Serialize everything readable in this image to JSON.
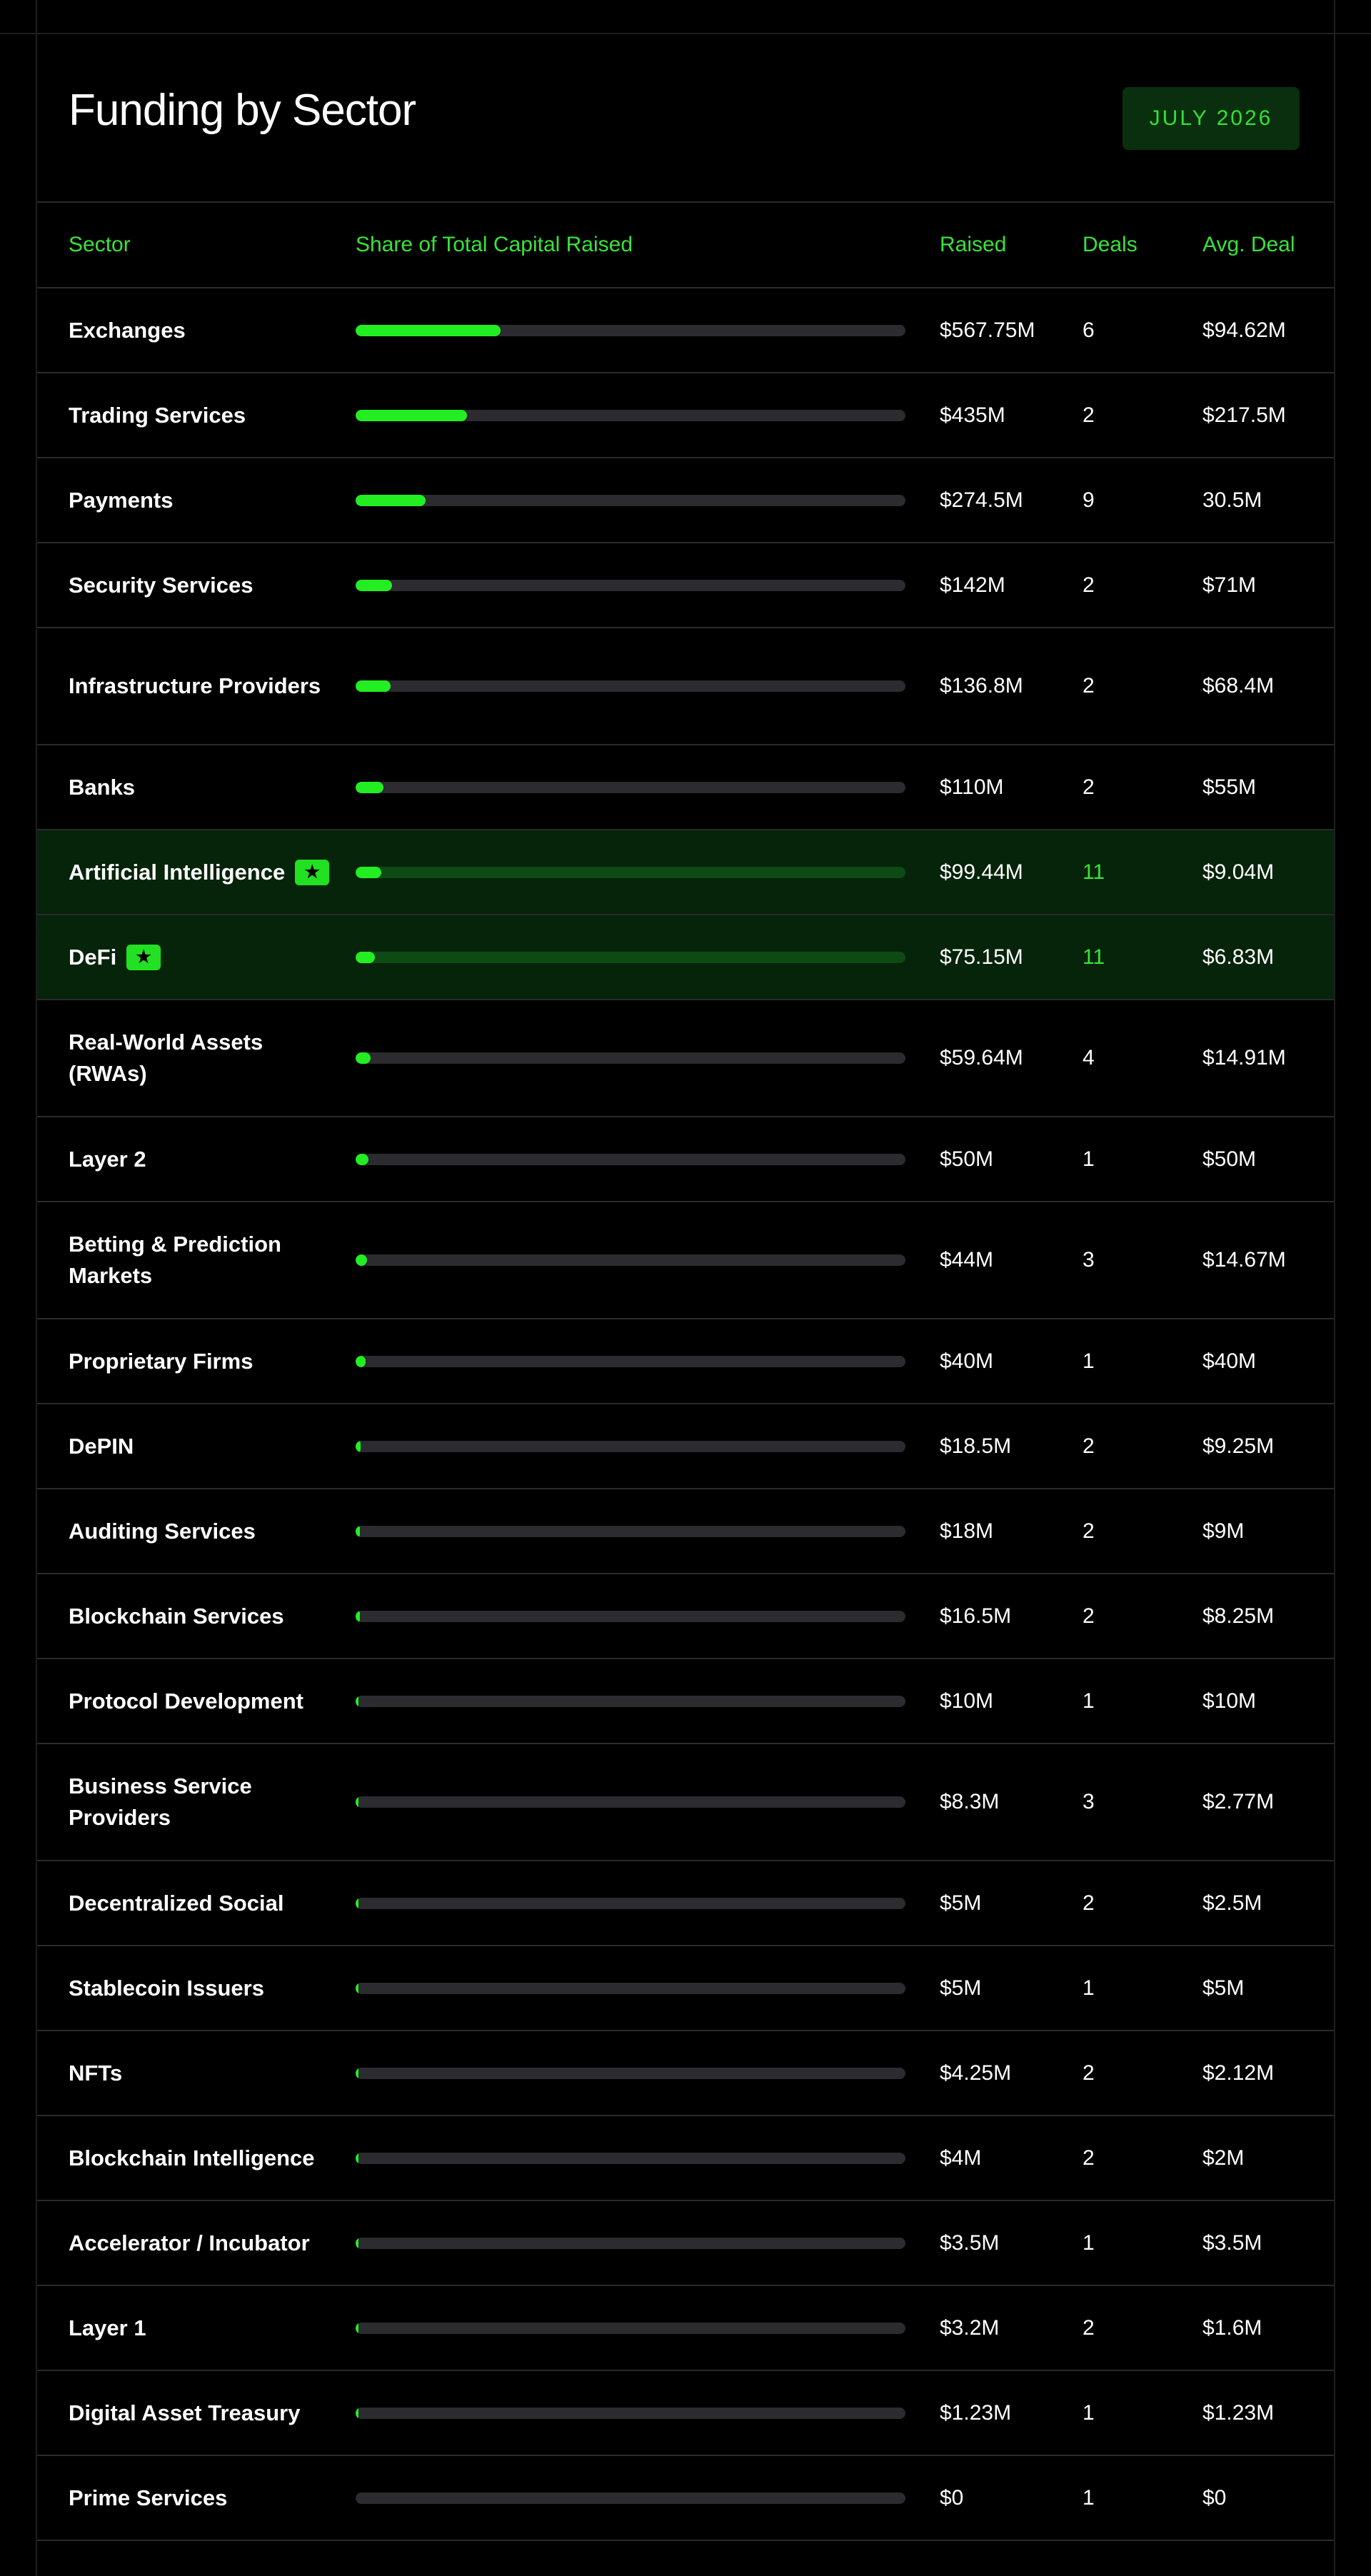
{
  "title": "Funding by Sector",
  "period_badge": "JULY 2026",
  "columns": {
    "sector": "Sector",
    "share": "Share of Total Capital Raised",
    "raised": "Raised",
    "deals": "Deals",
    "avg": "Avg. Deal"
  },
  "colors": {
    "accent": "#22ee22",
    "highlight_row": "#06240a",
    "track": "#2b2b30"
  },
  "chart_data": {
    "type": "table",
    "title": "Funding by Sector",
    "bar_max_millions": 2150,
    "rows": [
      {
        "sector": "Exchanges",
        "raised_m": 567.75,
        "raised": "$567.75M",
        "deals": "6",
        "avg": "$94.62M",
        "highlight": false
      },
      {
        "sector": "Trading Services",
        "raised_m": 435,
        "raised": "$435M",
        "deals": "2",
        "avg": "$217.5M",
        "highlight": false
      },
      {
        "sector": "Payments",
        "raised_m": 274.5,
        "raised": "$274.5M",
        "deals": "9",
        "avg": "30.5M",
        "highlight": false
      },
      {
        "sector": "Security Services",
        "raised_m": 142,
        "raised": "$142M",
        "deals": "2",
        "avg": "$71M",
        "highlight": false
      },
      {
        "sector": "Infrastructure Providers",
        "raised_m": 136.8,
        "raised": "$136.8M",
        "deals": "2",
        "avg": "$68.4M",
        "highlight": false
      },
      {
        "sector": "Banks",
        "raised_m": 110,
        "raised": "$110M",
        "deals": "2",
        "avg": "$55M",
        "highlight": false
      },
      {
        "sector": "Artificial Intelligence",
        "raised_m": 99.44,
        "raised": "$99.44M",
        "deals": "11",
        "avg": "$9.04M",
        "highlight": true
      },
      {
        "sector": "DeFi",
        "raised_m": 75.15,
        "raised": "$75.15M",
        "deals": "11",
        "avg": "$6.83M",
        "highlight": true
      },
      {
        "sector": "Real-World Assets (RWAs)",
        "raised_m": 59.64,
        "raised": "$59.64M",
        "deals": "4",
        "avg": "$14.91M",
        "highlight": false
      },
      {
        "sector": "Layer 2",
        "raised_m": 50,
        "raised": "$50M",
        "deals": "1",
        "avg": "$50M",
        "highlight": false
      },
      {
        "sector": "Betting & Prediction Markets",
        "raised_m": 44,
        "raised": "$44M",
        "deals": "3",
        "avg": "$14.67M",
        "highlight": false
      },
      {
        "sector": "Proprietary Firms",
        "raised_m": 40,
        "raised": "$40M",
        "deals": "1",
        "avg": "$40M",
        "highlight": false
      },
      {
        "sector": "DePIN",
        "raised_m": 18.5,
        "raised": "$18.5M",
        "deals": "2",
        "avg": "$9.25M",
        "highlight": false
      },
      {
        "sector": "Auditing Services",
        "raised_m": 18,
        "raised": "$18M",
        "deals": "2",
        "avg": "$9M",
        "highlight": false
      },
      {
        "sector": "Blockchain Services",
        "raised_m": 16.5,
        "raised": "$16.5M",
        "deals": "2",
        "avg": "$8.25M",
        "highlight": false
      },
      {
        "sector": "Protocol Development",
        "raised_m": 10,
        "raised": "$10M",
        "deals": "1",
        "avg": "$10M",
        "highlight": false
      },
      {
        "sector": "Business Service Providers",
        "raised_m": 8.3,
        "raised": "$8.3M",
        "deals": "3",
        "avg": "$2.77M",
        "highlight": false
      },
      {
        "sector": "Decentralized Social",
        "raised_m": 5,
        "raised": "$5M",
        "deals": "2",
        "avg": "$2.5M",
        "highlight": false
      },
      {
        "sector": "Stablecoin Issuers",
        "raised_m": 5,
        "raised": "$5M",
        "deals": "1",
        "avg": "$5M",
        "highlight": false
      },
      {
        "sector": "NFTs",
        "raised_m": 4.25,
        "raised": "$4.25M",
        "deals": "2",
        "avg": "$2.12M",
        "highlight": false
      },
      {
        "sector": "Blockchain Intelligence",
        "raised_m": 4,
        "raised": "$4M",
        "deals": "2",
        "avg": "$2M",
        "highlight": false
      },
      {
        "sector": "Accelerator / Incubator",
        "raised_m": 3.5,
        "raised": "$3.5M",
        "deals": "1",
        "avg": "$3.5M",
        "highlight": false
      },
      {
        "sector": "Layer 1",
        "raised_m": 3.2,
        "raised": "$3.2M",
        "deals": "2",
        "avg": "$1.6M",
        "highlight": false
      },
      {
        "sector": "Digital Asset Treasury",
        "raised_m": 1.23,
        "raised": "$1.23M",
        "deals": "1",
        "avg": "$1.23M",
        "highlight": false
      },
      {
        "sector": "Prime Services",
        "raised_m": 0,
        "raised": "$0",
        "deals": "1",
        "avg": "$0",
        "highlight": false
      }
    ]
  }
}
